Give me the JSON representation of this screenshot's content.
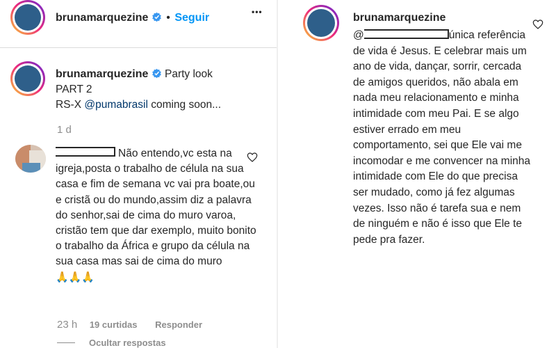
{
  "left": {
    "header": {
      "username": "bruna marquezine",
      "username_display": "brunamarquezine",
      "separator": "•",
      "follow_label": "Seguir",
      "more_label": "•••"
    },
    "post": {
      "username": "brunamarquezine",
      "caption_line1": "Party look",
      "caption_line2": "PART 2",
      "caption_line3_prefix": "RS-X ",
      "caption_mention": "@pumabrasil",
      "caption_line3_suffix": " coming soon...",
      "time": "1 d"
    },
    "comment": {
      "text_line1": "Não entendo,vc esta",
      "text_rest": "na igreja,posta o trabalho de célula na sua casa e fim de semana vc vai pra boate,ou e cristã ou do mundo,assim diz a palavra do senhor,sai de cima do muro varoa, cristão tem que dar exemplo, muito bonito o trabalho da África e grupo da célula na sua casa mas sai de cima do muro",
      "emoji": "🙏🙏🙏",
      "time": "23 h",
      "likes": "19 curtidas",
      "reply_label": "Responder",
      "hide_replies_label": "Ocultar respostas"
    }
  },
  "right": {
    "username": "brunamarquezine",
    "reply_prefix": "@",
    "reply_text_after_redaction": "única referência de vida é Jesus. E celebrar mais um ano de vida, dançar, sorrir, cercada de amigos queridos, não abala em nada meu relacionamento e minha intimidade com meu Pai. E se algo estiver errado em meu comportamento, sei que Ele vai me incomodar e me convencer na minha intimidade com Ele do que precisa ser mudado, como já fez algumas vezes. Isso não é tarefa sua e nem de ninguém e não é isso que Ele te pede pra fazer."
  },
  "colors": {
    "link_blue": "#0095f6",
    "mention_blue": "#00376b",
    "muted_gray": "#8e8e8e",
    "text": "#262626",
    "verified_blue": "#3897f0"
  },
  "icons": [
    "verified-badge-icon",
    "more-options-icon",
    "heart-icon",
    "pray-emoji-icon"
  ]
}
